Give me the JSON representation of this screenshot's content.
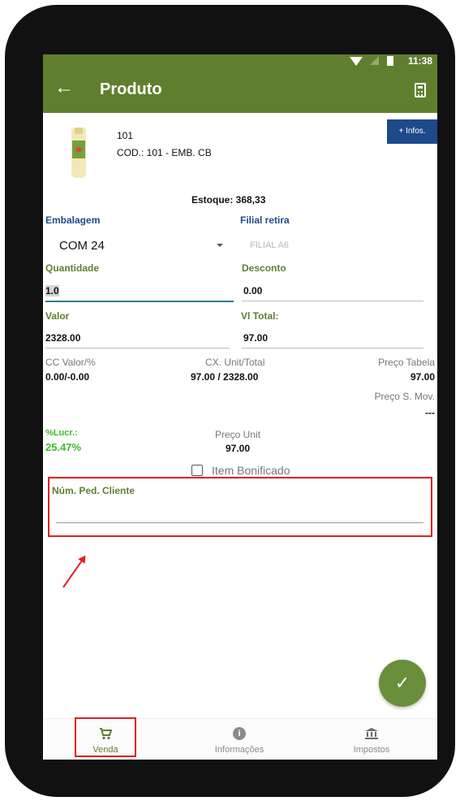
{
  "status_bar": {
    "time": "11:38"
  },
  "app_bar": {
    "title": "Produto",
    "back_icon": "arrow-left-icon",
    "calculator_icon": "calculator-icon"
  },
  "infos_button": "+ Infos.",
  "product": {
    "code": "101",
    "description": "COD.: 101 - EMB. CB"
  },
  "stock": "Estoque: 368,33",
  "embalagem": {
    "label": "Embalagem",
    "value": "COM 24"
  },
  "filial": {
    "label": "Filial retira",
    "value": "FILIAL A6"
  },
  "quantidade": {
    "label": "Quantidade",
    "value": "1.0"
  },
  "desconto": {
    "label": "Desconto",
    "value": "0.00"
  },
  "valor": {
    "label": "Valor",
    "value": "2328.00"
  },
  "vl_total": {
    "label": "Vl Total:",
    "value": "97.00"
  },
  "cc_valor": {
    "label": "CC Valor/%",
    "value": "0.00/-0.00"
  },
  "cx_unit": {
    "label": "CX. Unit/Total",
    "value": "97.00 / 2328.00"
  },
  "preco_tabela": {
    "label": "Preço Tabela",
    "value": "97.00"
  },
  "preco_smov": {
    "label": "Preço S. Mov.",
    "value": "---"
  },
  "lucro": {
    "label": "%Lucr.:",
    "value": "25.47%"
  },
  "preco_unit": {
    "label": "Preço Unit",
    "value": "97.00"
  },
  "item_bonificado": "Item Bonificado",
  "num_ped_cliente": {
    "label": "Núm. Ped. Cliente",
    "value": ""
  },
  "fab_icon": "check-icon",
  "bottom_nav": [
    {
      "label": "Venda",
      "icon": "cart-icon"
    },
    {
      "label": "Informações",
      "icon": "info-icon"
    },
    {
      "label": "Impostos",
      "icon": "bank-icon"
    }
  ],
  "colors": {
    "primary": "#5f7f2e",
    "accent_blue": "#1e4a8c",
    "highlight_red": "#e02020",
    "profit_green": "#3cbd2a"
  }
}
